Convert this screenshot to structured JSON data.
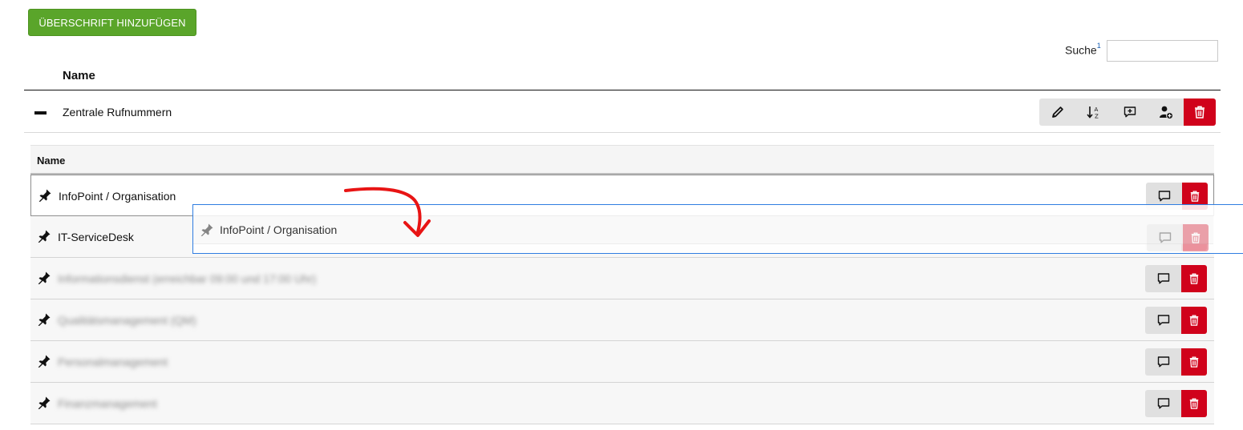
{
  "toolbar": {
    "add_heading_label": "ÜBERSCHRIFT HINZUFÜGEN"
  },
  "search": {
    "label": "Suche",
    "footnote": "1",
    "value": "",
    "placeholder": ""
  },
  "outer_table": {
    "column_header": "Name"
  },
  "group": {
    "name": "Zentrale Rufnummern",
    "expanded": true,
    "actions": [
      "pencil-icon",
      "sort-alpha-icon",
      "comment-add-icon",
      "user-add-icon",
      "trash-icon"
    ]
  },
  "inner_table": {
    "column_header": "Name",
    "rows": [
      {
        "label": "InfoPoint / Organisation",
        "blurred": false
      },
      {
        "label": "IT-ServiceDesk",
        "blurred": false
      },
      {
        "label": "Informationsdienst (erreichbar 09:00 und 17:00 Uhr)",
        "blurred": true
      },
      {
        "label": "Qualitätsmanagement (QM)",
        "blurred": true
      },
      {
        "label": "Personalmanagement",
        "blurred": true
      },
      {
        "label": "Finanzmanagement",
        "blurred": true
      }
    ]
  },
  "drag_ghost": {
    "label": "InfoPoint / Organisation"
  },
  "colors": {
    "add_button": "#5aa52a",
    "danger": "#d0021b",
    "drag_outline": "#2f7de1",
    "annotation_arrow": "#e81414"
  }
}
